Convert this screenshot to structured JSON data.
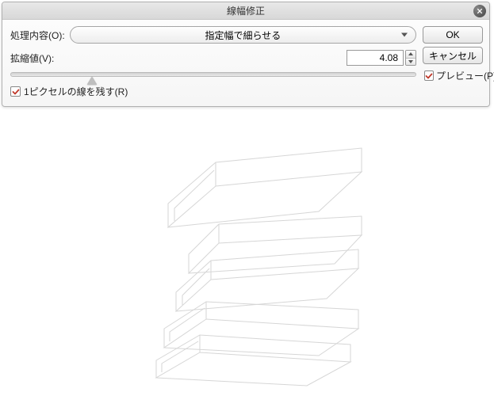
{
  "dialog": {
    "title": "線幅修正",
    "process_label": "処理内容(O):",
    "process_value": "指定幅で細らせる",
    "scale_label": "拡縮値(V):",
    "scale_value": "4.08",
    "keep_1px_label": "1ピクセルの線を残す(R)",
    "keep_1px_checked": true
  },
  "buttons": {
    "ok": "OK",
    "cancel": "キャンセル",
    "preview": "プレビュー(P)",
    "preview_checked": true
  }
}
